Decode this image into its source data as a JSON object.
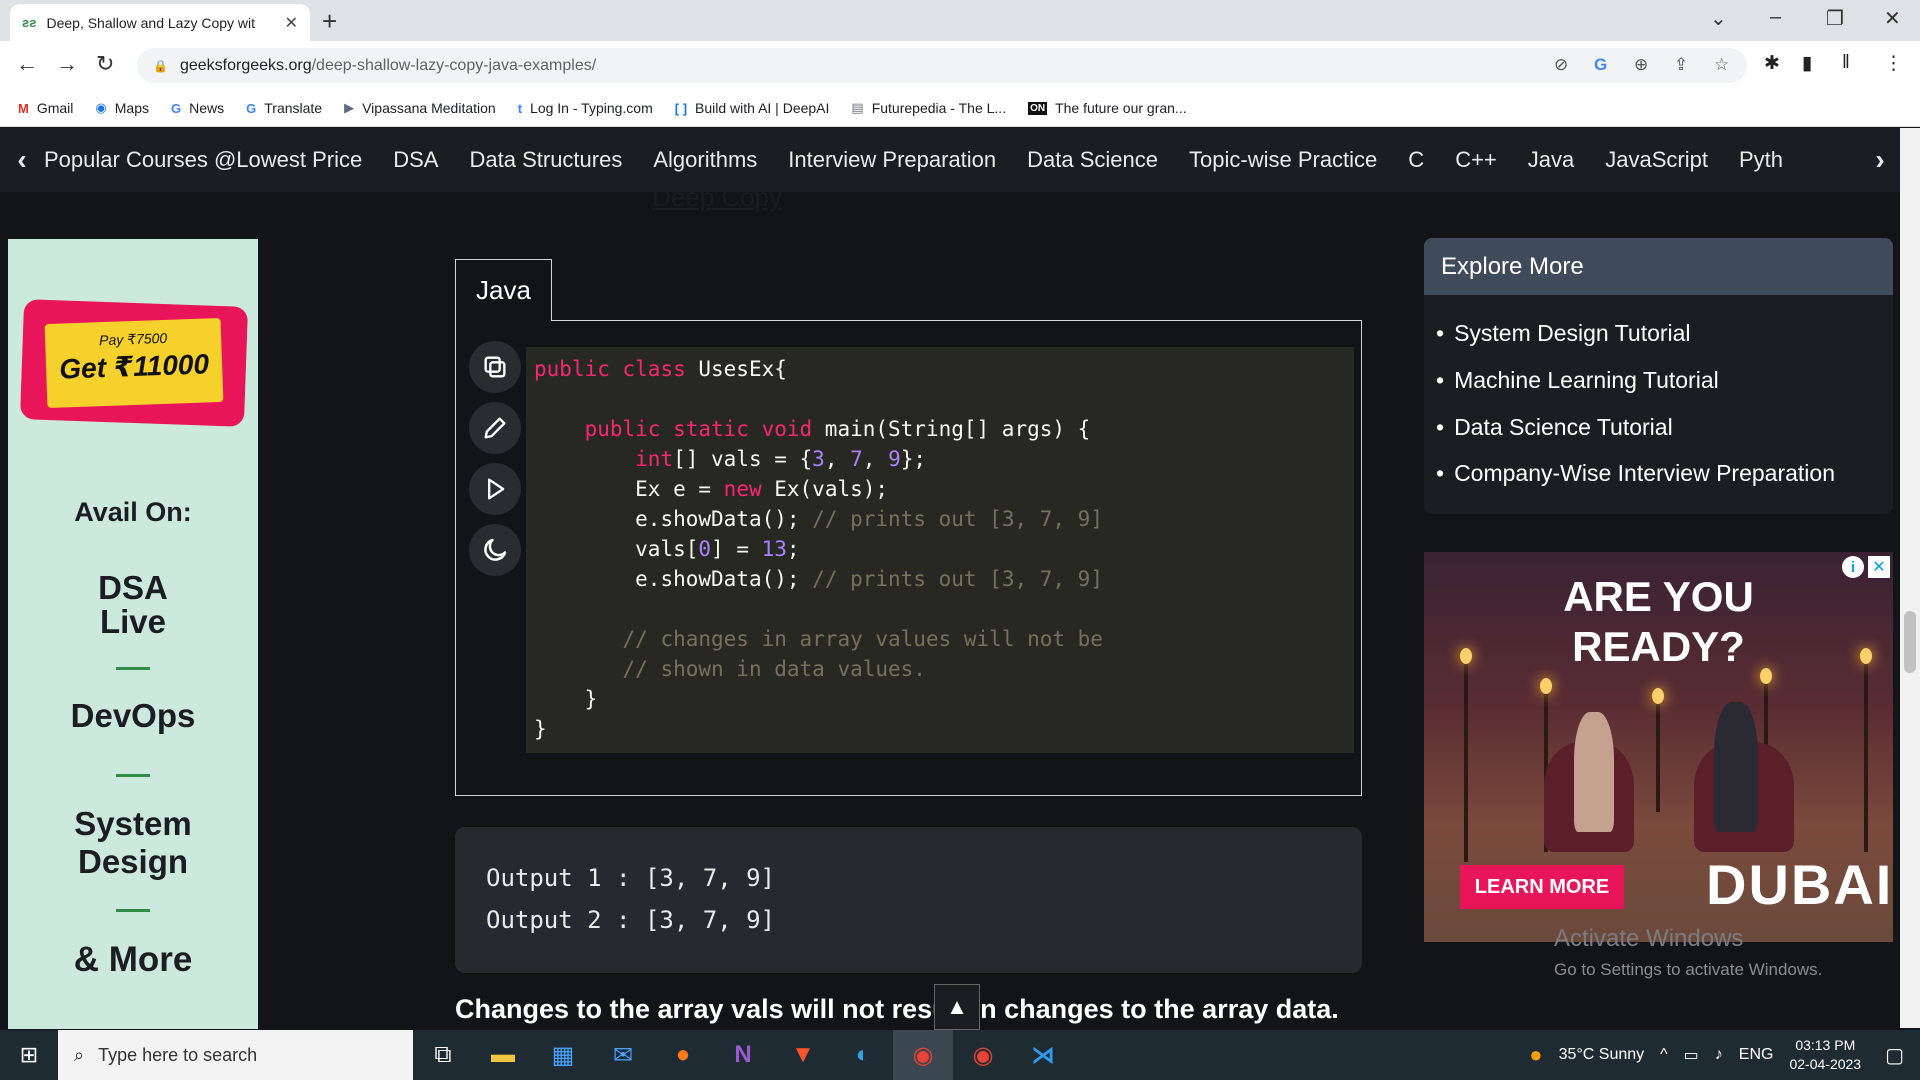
{
  "browser": {
    "tab_title": "Deep, Shallow and Lazy Copy wit",
    "url_domain": "geeksforgeeks.org",
    "url_path": "/deep-shallow-lazy-copy-java-examples/",
    "bookmarks": [
      {
        "label": "Gmail",
        "icon": "M",
        "color": "#d93025"
      },
      {
        "label": "Maps",
        "icon": "◉",
        "color": "#1a73e8"
      },
      {
        "label": "News",
        "icon": "G",
        "color": "#4285f4"
      },
      {
        "label": "Translate",
        "icon": "G",
        "color": "#4285f4"
      },
      {
        "label": "Vipassana Meditation",
        "icon": "▶",
        "color": "#5a6b7a"
      },
      {
        "label": "Log In - Typing.com",
        "icon": "t",
        "color": "#3b82f6"
      },
      {
        "label": "Build with AI | DeepAI",
        "icon": "[ ]",
        "color": "#1a73e8"
      },
      {
        "label": "Futurepedia - The L...",
        "icon": "▤",
        "color": "#6b7280"
      },
      {
        "label": "The future our gran...",
        "icon": "ON",
        "color": "#111111"
      }
    ]
  },
  "nav": {
    "items": [
      "Popular Courses @Lowest Price",
      "DSA",
      "Data Structures",
      "Algorithms",
      "Interview Preparation",
      "Data Science",
      "Topic-wise Practice",
      "C",
      "C++",
      "Java",
      "JavaScript",
      "Pyth"
    ],
    "partial_link": "Deep Copy"
  },
  "left_ad": {
    "pay": "Pay ₹7500",
    "get": "Get ₹11000",
    "avail": "Avail On:",
    "dsa": "DSA",
    "live": "Live",
    "devops": "DevOps",
    "system": "System",
    "design": "Design",
    "more": "& More"
  },
  "code": {
    "tab_label": "Java",
    "line1_kw1": "public",
    "line1_kw2": "class",
    "line1_rest": " UsesEx{",
    "line2_kw": "public static void",
    "line2_rest": " main(String[] args) {",
    "line3_kw": "int",
    "line3_a": "[] vals = {",
    "line3_n1": "3",
    "line3_c1": ", ",
    "line3_n2": "7",
    "line3_c2": ", ",
    "line3_n3": "9",
    "line3_end": "};",
    "line4_a": "Ex e = ",
    "line4_kw": "new",
    "line4_b": " Ex(vals);",
    "line5_a": "e.showData(); ",
    "line5_cm": "// prints out [3, 7, 9]",
    "line6_a": "vals[",
    "line6_n0": "0",
    "line6_b": "] = ",
    "line6_n13": "13",
    "line6_c": ";",
    "line7_a": "e.showData(); ",
    "line7_cm": "// prints out [3, 7, 9]",
    "line8_cm": "// changes in array values will not be",
    "line9_cm": "// shown in data values.",
    "line10": "}",
    "line11": "}"
  },
  "output": {
    "line1": "Output 1 : [3, 7, 9]",
    "line2": "Output 2 : [3, 7, 9]"
  },
  "bottom_text": "Changes to the array vals will not result in changes to the array data.",
  "explore": {
    "title": "Explore More",
    "items": [
      "System Design Tutorial",
      "Machine Learning Tutorial",
      "Data Science Tutorial",
      "Company-Wise Interview Preparation"
    ]
  },
  "right_ad": {
    "headline1": "ARE YOU",
    "headline2": "READY?",
    "cta": "LEARN MORE",
    "brand": "DUBAI"
  },
  "watermark": {
    "title": "Activate Windows",
    "subtitle": "Go to Settings to activate Windows."
  },
  "taskbar": {
    "search_placeholder": "Type here to search",
    "weather": "35°C  Sunny",
    "language": "ENG",
    "time": "03:13 PM",
    "date": "02-04-2023"
  }
}
